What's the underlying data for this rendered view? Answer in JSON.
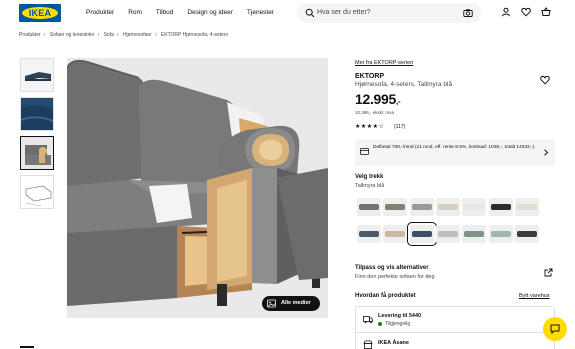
{
  "header": {
    "logo_text": "IKEA",
    "nav": [
      "Produkter",
      "Rom",
      "Tilbud",
      "Design og ideer",
      "Tjenester"
    ],
    "search_placeholder": "Hva ser du etter?",
    "icons": [
      "search-icon",
      "camera-icon",
      "user-icon",
      "heart-icon",
      "cart-icon"
    ]
  },
  "breadcrumb": [
    "Produkter",
    "Sofaer og lenestoler",
    "Sofa",
    "Hjørnesofaer",
    "EKTORP Hjørnesofa, 4-seters"
  ],
  "media": {
    "all_media_label": "Alle medier",
    "thumbnail_count": 4,
    "active_thumbnail": 3
  },
  "product": {
    "series_link": "Mer fra EKTORP-serien",
    "name": "EKTORP",
    "description": "Hjørnesofa, 4-seters, Tallmyra blå",
    "price": "12.995",
    "price_suffix": ",-",
    "price_sub": "10.396,- ekskl. mva",
    "stars": "★★★★☆",
    "reviews": "(117)",
    "financing": "Delbetal 700,-/mnd (21 mnd, eff. rente 8.9%, kostnad: 1038,-, totalt 14033,-)."
  },
  "colors": {
    "heading": "Velg trekk",
    "selected_name": "Tallmyra blå",
    "swatches": [
      {
        "name": "grey-dark",
        "bg": "#eeeeee",
        "sofa": "#6e7370"
      },
      {
        "name": "grey-green",
        "bg": "#eeeeee",
        "sofa": "#7c8471"
      },
      {
        "name": "grey-light",
        "bg": "#eeeeee",
        "sofa": "#9a9a96"
      },
      {
        "name": "beige",
        "bg": "#eeeeee",
        "sofa": "#d8cdbf"
      },
      {
        "name": "white",
        "bg": "#eeeeee",
        "sofa": "#e8e6e1"
      },
      {
        "name": "black",
        "bg": "#eeeeee",
        "sofa": "#2b2b2b"
      },
      {
        "name": "off-white",
        "bg": "#eeeeee",
        "sofa": "#e3ddd0"
      },
      {
        "name": "blue-grey",
        "bg": "#eeeeee",
        "sofa": "#4c5b6b"
      },
      {
        "name": "sand",
        "bg": "#eeeeee",
        "sofa": "#cbb9a2"
      },
      {
        "name": "tallmyra-blue",
        "bg": "#eeeeee",
        "sofa": "#3b4d63"
      },
      {
        "name": "light-grey",
        "bg": "#eeeeee",
        "sofa": "#bdbdb9"
      },
      {
        "name": "sage",
        "bg": "#eeeeee",
        "sofa": "#7f9385"
      },
      {
        "name": "mint",
        "bg": "#eeeeee",
        "sofa": "#9fb7b0"
      },
      {
        "name": "charcoal",
        "bg": "#eeeeee",
        "sofa": "#3a3b3c"
      }
    ],
    "selected_index": 9
  },
  "customize": {
    "heading": "Tilpass og vis alternativer",
    "sub": "Finn den perfekte sofaen for deg"
  },
  "delivery": {
    "heading": "Hvordan få produktet",
    "change_store": "Bytt varehus",
    "rows": [
      {
        "title": "Levering til 5440",
        "status": "Tilgjengelig"
      },
      {
        "title": "IKEA Åsane",
        "status": ""
      }
    ]
  },
  "colors_theme": {
    "brand_blue": "#0058a3",
    "brand_yellow": "#ffdb00",
    "available_green": "#0a8a00"
  }
}
